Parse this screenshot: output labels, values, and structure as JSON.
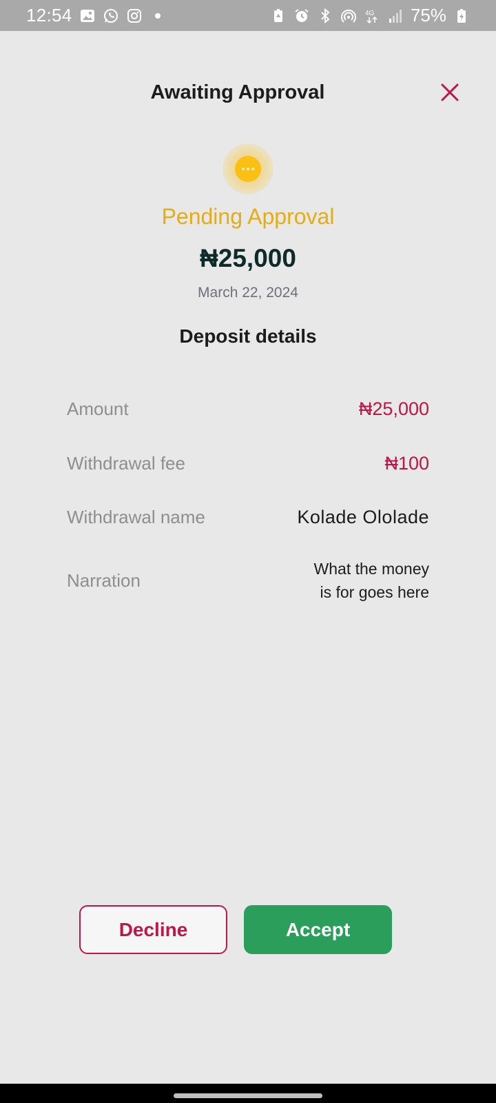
{
  "status_bar": {
    "time": "12:54",
    "battery": "75%",
    "left_icons": [
      "gallery-icon",
      "whatsapp-icon",
      "instagram-icon"
    ],
    "right_icons": [
      "battery-saver-icon",
      "alarm-icon",
      "bluetooth-icon",
      "hotspot-icon",
      "network-4g-icon",
      "signal-icon",
      "battery-icon"
    ]
  },
  "header": {
    "title": "Awaiting Approval"
  },
  "status": {
    "label": "Pending Approval",
    "amount": "₦25,000",
    "date": "March 22, 2024"
  },
  "details": {
    "title": "Deposit details",
    "rows": [
      {
        "label": "Amount",
        "value": "₦25,000"
      },
      {
        "label": "Withdrawal fee",
        "value": "₦100"
      },
      {
        "label": "Withdrawal name",
        "value": "Kolade Ololade"
      },
      {
        "label": "Narration",
        "value_line1": "What the money",
        "value_line2": "is for goes here"
      }
    ]
  },
  "actions": {
    "decline_label": "Decline",
    "accept_label": "Accept"
  },
  "colors": {
    "accent_red": "#c0174a",
    "accept_green": "#2b9e5c",
    "pending_yellow": "#fcbf14",
    "pending_text": "#e5ac16",
    "background": "#e8e8e8"
  }
}
